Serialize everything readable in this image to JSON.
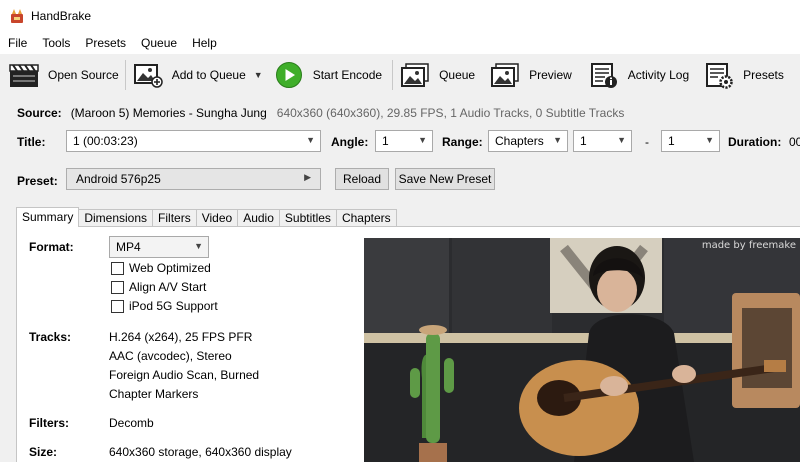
{
  "window": {
    "title": "HandBrake"
  },
  "menu": [
    "File",
    "Tools",
    "Presets",
    "Queue",
    "Help"
  ],
  "toolbar": {
    "open_source": "Open Source",
    "add_to_queue": "Add to Queue",
    "start_encode": "Start Encode",
    "queue": "Queue",
    "preview": "Preview",
    "activity_log": "Activity Log",
    "presets": "Presets"
  },
  "source": {
    "label": "Source:",
    "name": "(Maroon 5) Memories - Sungha Jung",
    "details": "640x360 (640x360), 29.85 FPS, 1 Audio Tracks, 0 Subtitle Tracks"
  },
  "title_row": {
    "title_label": "Title:",
    "title_value": "1  (00:03:23)",
    "angle_label": "Angle:",
    "angle_value": "1",
    "range_label": "Range:",
    "range_value": "Chapters",
    "range_start": "1",
    "dash": "-",
    "range_end": "1",
    "duration_label": "Duration:",
    "duration_value": "00"
  },
  "preset_row": {
    "label": "Preset:",
    "value": "Android 576p25",
    "reload": "Reload",
    "save_new": "Save New Preset"
  },
  "tabs": [
    "Summary",
    "Dimensions",
    "Filters",
    "Video",
    "Audio",
    "Subtitles",
    "Chapters"
  ],
  "summary": {
    "format_label": "Format:",
    "format_value": "MP4",
    "web_optimized": "Web Optimized",
    "align_av": "Align A/V Start",
    "ipod": "iPod 5G Support",
    "tracks_label": "Tracks:",
    "tracks": [
      "H.264 (x264), 25 FPS PFR",
      "AAC (avcodec), Stereo",
      "Foreign Audio Scan, Burned",
      "Chapter Markers"
    ],
    "filters_label": "Filters:",
    "filters_value": "Decomb",
    "size_label": "Size:",
    "size_value": "640x360 storage, 640x360 display"
  },
  "preview": {
    "watermark": "made by freemake"
  },
  "colors": {
    "accent_green": "#3fae2a",
    "window_bg": "#f0f0f0"
  }
}
